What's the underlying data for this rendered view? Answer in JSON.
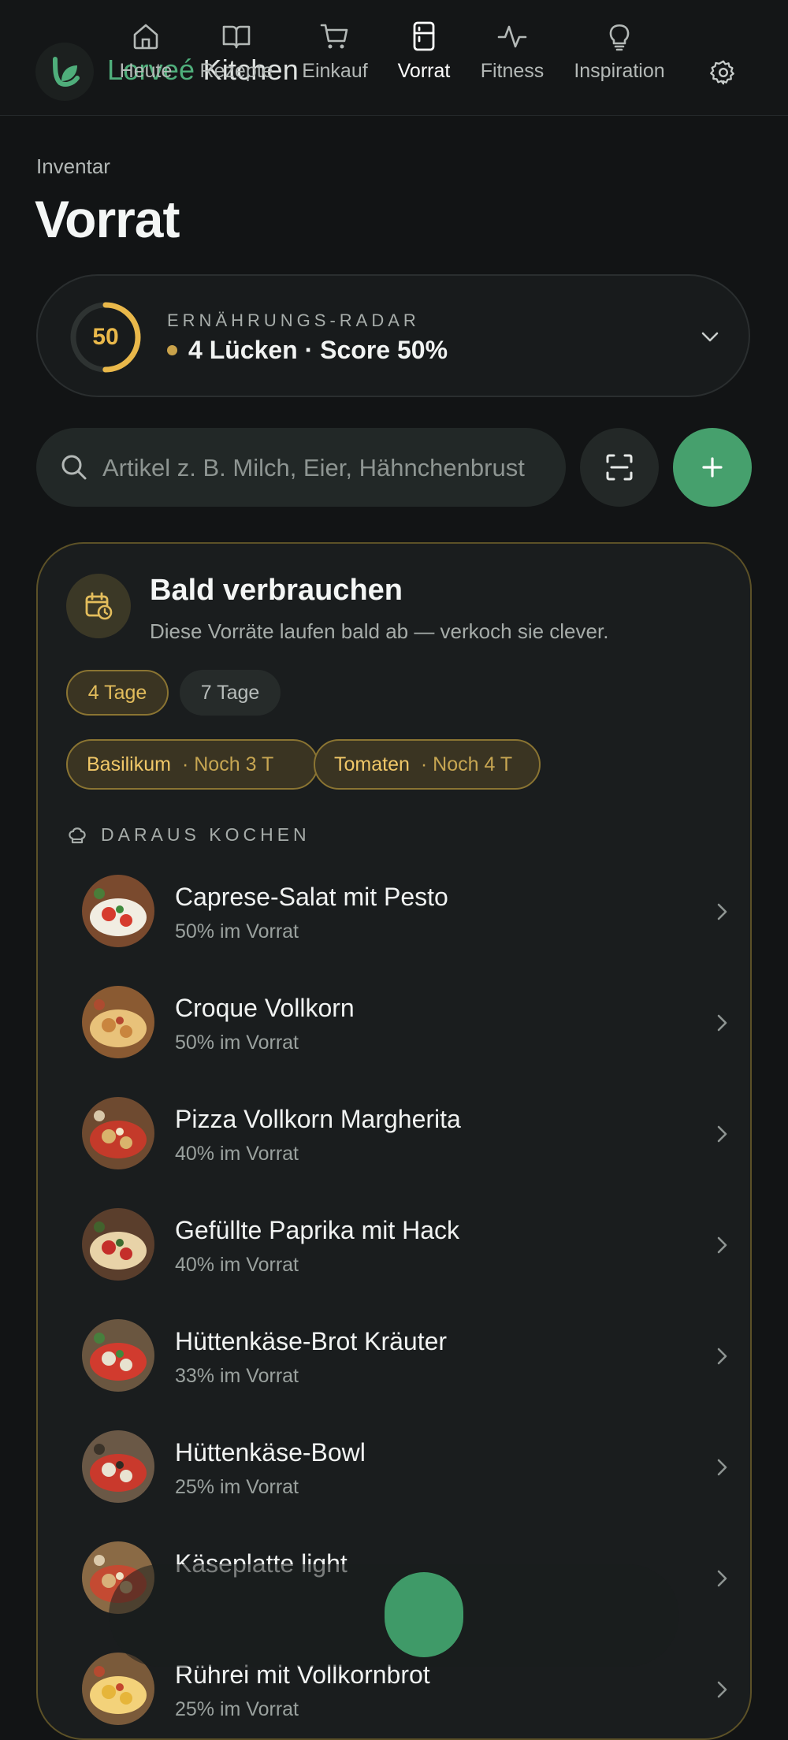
{
  "header": {
    "brand_first": "Lorveé",
    "brand_second": "Kitchen"
  },
  "page": {
    "eyebrow": "Inventar",
    "title": "Vorrat"
  },
  "radar": {
    "label": "ERNÄHRUNGS-RADAR",
    "score": "50",
    "score_fraction": 0.5,
    "status": "4 Lücken · Score 50%"
  },
  "search": {
    "placeholder": "Artikel z. B. Milch, Eier, Hähnchenbrust"
  },
  "soon": {
    "title": "Bald verbrauchen",
    "subtitle": "Diese Vorräte laufen bald ab — verkoch sie clever.",
    "filters": [
      {
        "label": "4 Tage",
        "active": true
      },
      {
        "label": "7 Tage",
        "active": false
      }
    ],
    "ingredients": [
      {
        "name": "Basilikum",
        "days": "· Noch 3 T"
      },
      {
        "name": "Tomaten",
        "days": "· Noch 4 T"
      }
    ],
    "cook_label": "DARAUS KOCHEN",
    "recipes": [
      {
        "name": "Caprese-Salat mit Pesto",
        "stock": "50% im Vorrat"
      },
      {
        "name": "Croque Vollkorn",
        "stock": "50% im Vorrat"
      },
      {
        "name": "Pizza Vollkorn Margherita",
        "stock": "40% im Vorrat"
      },
      {
        "name": "Gefüllte Paprika mit Hack",
        "stock": "40% im Vorrat"
      },
      {
        "name": "Hüttenkäse-Brot Kräuter",
        "stock": "33% im Vorrat"
      },
      {
        "name": "Hüttenkäse-Bowl",
        "stock": "25% im Vorrat"
      },
      {
        "name": "Käseplatte light",
        "stock": ""
      },
      {
        "name": "Rührei mit Vollkornbrot",
        "stock": "25% im Vorrat"
      }
    ]
  },
  "nav": {
    "items": [
      {
        "label": "Heute",
        "icon": "home-icon"
      },
      {
        "label": "Rezepte",
        "icon": "book-icon"
      },
      {
        "label": "Einkauf",
        "icon": "cart-icon"
      },
      {
        "label": "Vorrat",
        "icon": "fridge-icon",
        "active": true
      },
      {
        "label": "Fitness",
        "icon": "activity-icon"
      },
      {
        "label": "Inspiration",
        "icon": "lightbulb-icon"
      }
    ]
  },
  "colors": {
    "accent_green": "#46a06d",
    "accent_gold": "#e9b84a",
    "background": "#121415"
  }
}
